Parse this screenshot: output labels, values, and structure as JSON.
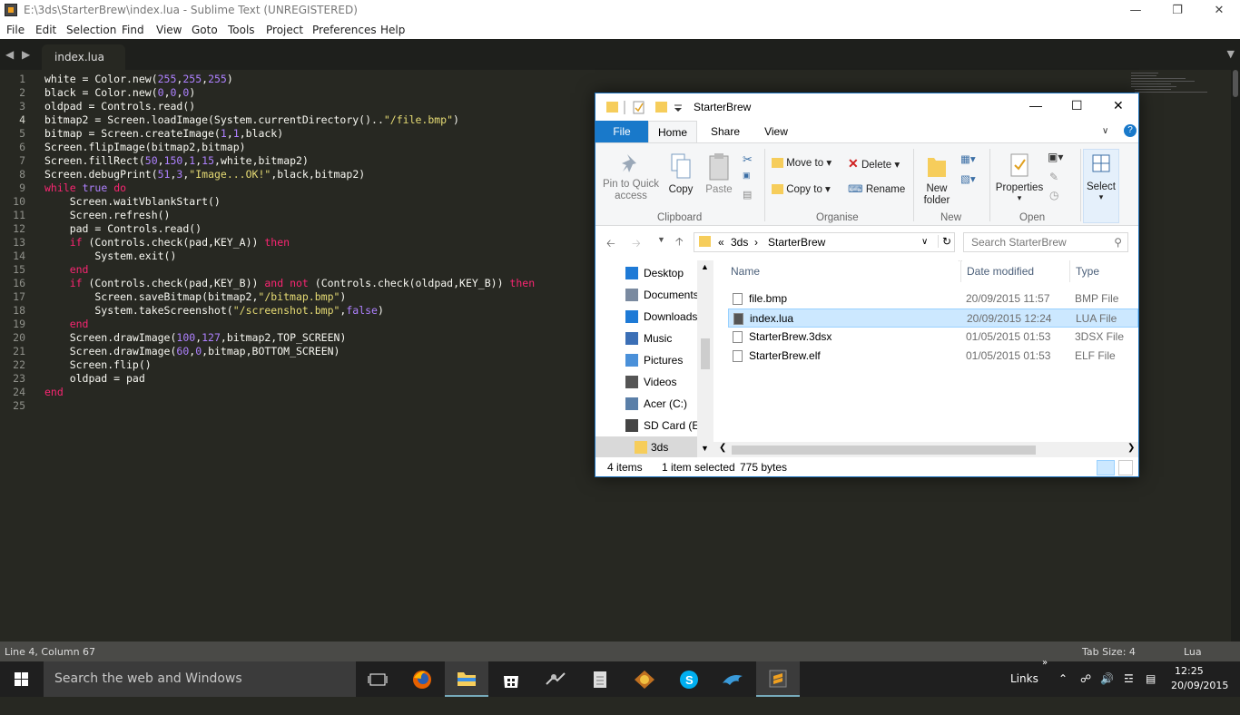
{
  "window": {
    "title": "E:\\3ds\\StarterBrew\\index.lua - Sublime Text (UNREGISTERED)"
  },
  "menu": [
    "File",
    "Edit",
    "Selection",
    "Find",
    "View",
    "Goto",
    "Tools",
    "Project",
    "Preferences",
    "Help"
  ],
  "tab": {
    "label": "index.lua"
  },
  "code": [
    [
      [
        "v",
        "white = Color.new("
      ],
      [
        "n",
        "255"
      ],
      [
        "v",
        ","
      ],
      [
        "n",
        "255"
      ],
      [
        "v",
        ","
      ],
      [
        "n",
        "255"
      ],
      [
        "v",
        ")"
      ]
    ],
    [
      [
        "v",
        "black = Color.new("
      ],
      [
        "n",
        "0"
      ],
      [
        "v",
        ","
      ],
      [
        "n",
        "0"
      ],
      [
        "v",
        ","
      ],
      [
        "n",
        "0"
      ],
      [
        "v",
        ")"
      ]
    ],
    [
      [
        "v",
        "oldpad = Controls.read()"
      ]
    ],
    [
      [
        "v",
        "bitmap2 = Screen.loadImage(System.currentDirectory().."
      ],
      [
        "s",
        "\"/file.bmp\""
      ],
      [
        "v",
        ")"
      ]
    ],
    [
      [
        "v",
        "bitmap = Screen.createImage("
      ],
      [
        "n",
        "1"
      ],
      [
        "v",
        ","
      ],
      [
        "n",
        "1"
      ],
      [
        "v",
        ",black)"
      ]
    ],
    [
      [
        "v",
        "Screen.flipImage(bitmap2,bitmap)"
      ]
    ],
    [
      [
        "v",
        "Screen.fillRect("
      ],
      [
        "n",
        "50"
      ],
      [
        "v",
        ","
      ],
      [
        "n",
        "150"
      ],
      [
        "v",
        ","
      ],
      [
        "n",
        "1"
      ],
      [
        "v",
        ","
      ],
      [
        "n",
        "15"
      ],
      [
        "v",
        ",white,bitmap2)"
      ]
    ],
    [
      [
        "v",
        "Screen.debugPrint("
      ],
      [
        "n",
        "51"
      ],
      [
        "v",
        ","
      ],
      [
        "n",
        "3"
      ],
      [
        "v",
        ","
      ],
      [
        "s",
        "\"Image...OK!\""
      ],
      [
        "v",
        ",black,bitmap2)"
      ]
    ],
    [
      [
        "k",
        "while"
      ],
      [
        "v",
        " "
      ],
      [
        "n",
        "true"
      ],
      [
        "v",
        " "
      ],
      [
        "k",
        "do"
      ]
    ],
    [
      [
        "v",
        "    Screen.waitVblankStart()"
      ]
    ],
    [
      [
        "v",
        "    Screen.refresh()"
      ]
    ],
    [
      [
        "v",
        "    pad = Controls.read()"
      ]
    ],
    [
      [
        "v",
        "    "
      ],
      [
        "k",
        "if"
      ],
      [
        "v",
        " (Controls.check(pad,KEY_A)) "
      ],
      [
        "k",
        "then"
      ]
    ],
    [
      [
        "v",
        "        System.exit()"
      ]
    ],
    [
      [
        "v",
        "    "
      ],
      [
        "k",
        "end"
      ]
    ],
    [
      [
        "v",
        "    "
      ],
      [
        "k",
        "if"
      ],
      [
        "v",
        " (Controls.check(pad,KEY_B)) "
      ],
      [
        "k",
        "and"
      ],
      [
        "v",
        " "
      ],
      [
        "k",
        "not"
      ],
      [
        "v",
        " (Controls.check(oldpad,KEY_B)) "
      ],
      [
        "k",
        "then"
      ]
    ],
    [
      [
        "v",
        "        Screen.saveBitmap(bitmap2,"
      ],
      [
        "s",
        "\"/bitmap.bmp\""
      ],
      [
        "v",
        ")"
      ]
    ],
    [
      [
        "v",
        "        System.takeScreenshot("
      ],
      [
        "s",
        "\"/screenshot.bmp\""
      ],
      [
        "v",
        ","
      ],
      [
        "n",
        "false"
      ],
      [
        "v",
        ")"
      ]
    ],
    [
      [
        "v",
        "    "
      ],
      [
        "k",
        "end"
      ]
    ],
    [
      [
        "v",
        "    Screen.drawImage("
      ],
      [
        "n",
        "100"
      ],
      [
        "v",
        ","
      ],
      [
        "n",
        "127"
      ],
      [
        "v",
        ",bitmap2,TOP_SCREEN)"
      ]
    ],
    [
      [
        "v",
        "    Screen.drawImage("
      ],
      [
        "n",
        "60"
      ],
      [
        "v",
        ","
      ],
      [
        "n",
        "0"
      ],
      [
        "v",
        ",bitmap,BOTTOM_SCREEN)"
      ]
    ],
    [
      [
        "v",
        "    Screen.flip()"
      ]
    ],
    [
      [
        "v",
        "    oldpad = pad"
      ]
    ],
    [
      [
        "k",
        "end"
      ]
    ],
    [
      [
        "v",
        ""
      ]
    ]
  ],
  "current_line": 4,
  "status": {
    "position": "Line 4, Column 67",
    "tab_size": "Tab Size: 4",
    "syntax": "Lua"
  },
  "explorer": {
    "title": "StarterBrew",
    "ribbon_tabs": [
      "File",
      "Home",
      "Share",
      "View"
    ],
    "ribbon": {
      "pin": "Pin to Quick access",
      "copy": "Copy",
      "paste": "Paste",
      "clipboard": "Clipboard",
      "move_to": "Move to",
      "copy_to": "Copy to",
      "delete": "Delete",
      "rename": "Rename",
      "organise": "Organise",
      "new_folder": "New folder",
      "new": "New",
      "properties": "Properties",
      "open": "Open",
      "select": "Select"
    },
    "breadcrumb": [
      "«",
      "3ds",
      "›",
      "StarterBrew"
    ],
    "search_placeholder": "Search StarterBrew",
    "nav": [
      {
        "label": "Desktop",
        "color": "#1e7ad6"
      },
      {
        "label": "Documents",
        "color": "#7a8aa0"
      },
      {
        "label": "Downloads",
        "color": "#1e7ad6"
      },
      {
        "label": "Music",
        "color": "#3b6fb6"
      },
      {
        "label": "Pictures",
        "color": "#4a90d9"
      },
      {
        "label": "Videos",
        "color": "#555"
      },
      {
        "label": "Acer (C:)",
        "color": "#5a7fa8"
      },
      {
        "label": "SD Card (E:)",
        "color": "#444"
      },
      {
        "label": "3ds",
        "color": "#f6cd5b"
      }
    ],
    "columns": [
      "Name",
      "Date modified",
      "Type"
    ],
    "files": [
      {
        "name": "file.bmp",
        "date": "20/09/2015 11:57",
        "type": "BMP File"
      },
      {
        "name": "index.lua",
        "date": "20/09/2015 12:24",
        "type": "LUA File"
      },
      {
        "name": "StarterBrew.3dsx",
        "date": "01/05/2015 01:53",
        "type": "3DSX File"
      },
      {
        "name": "StarterBrew.elf",
        "date": "01/05/2015 01:53",
        "type": "ELF File"
      }
    ],
    "selected_file": 1,
    "status": {
      "count": "4 items",
      "selection": "1 item selected",
      "size": "775 bytes"
    }
  },
  "taskbar": {
    "search": "Search the web and Windows",
    "links": "Links",
    "time": "12:25",
    "date": "20/09/2015"
  },
  "colors": {
    "editor_bg": "#272822",
    "keyword": "#f92672",
    "number": "#ae81ff",
    "string": "#e6db74",
    "accent": "#1e73be"
  }
}
